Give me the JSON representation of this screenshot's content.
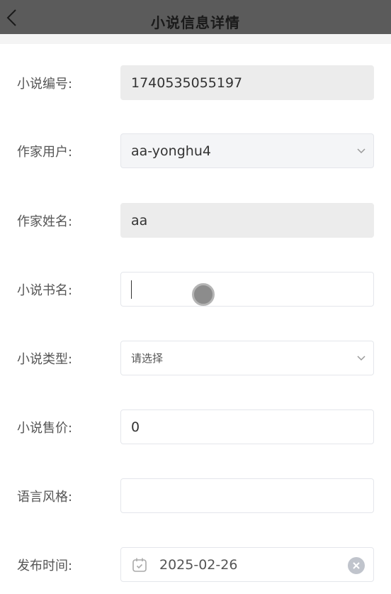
{
  "header": {
    "title": "小说信息详情"
  },
  "form": {
    "novel_id": {
      "label": "小说编号:",
      "value": "1740535055197"
    },
    "author_user": {
      "label": "作家用户:",
      "value": "aa-yonghu4"
    },
    "author_name": {
      "label": "作家姓名:",
      "value": "aa"
    },
    "book_name": {
      "label": "小说书名:",
      "value": ""
    },
    "novel_type": {
      "label": "小说类型:",
      "placeholder": "请选择"
    },
    "price": {
      "label": "小说售价:",
      "value": "0"
    },
    "language_style": {
      "label": "语言风格:",
      "value": ""
    },
    "publish_time": {
      "label": "发布时间:",
      "value": "2025-02-26"
    }
  },
  "icons": {
    "back": "chevron-left-icon",
    "dropdown": "chevron-down-icon",
    "calendar": "calendar-icon",
    "clear": "clear-circle-icon"
  }
}
